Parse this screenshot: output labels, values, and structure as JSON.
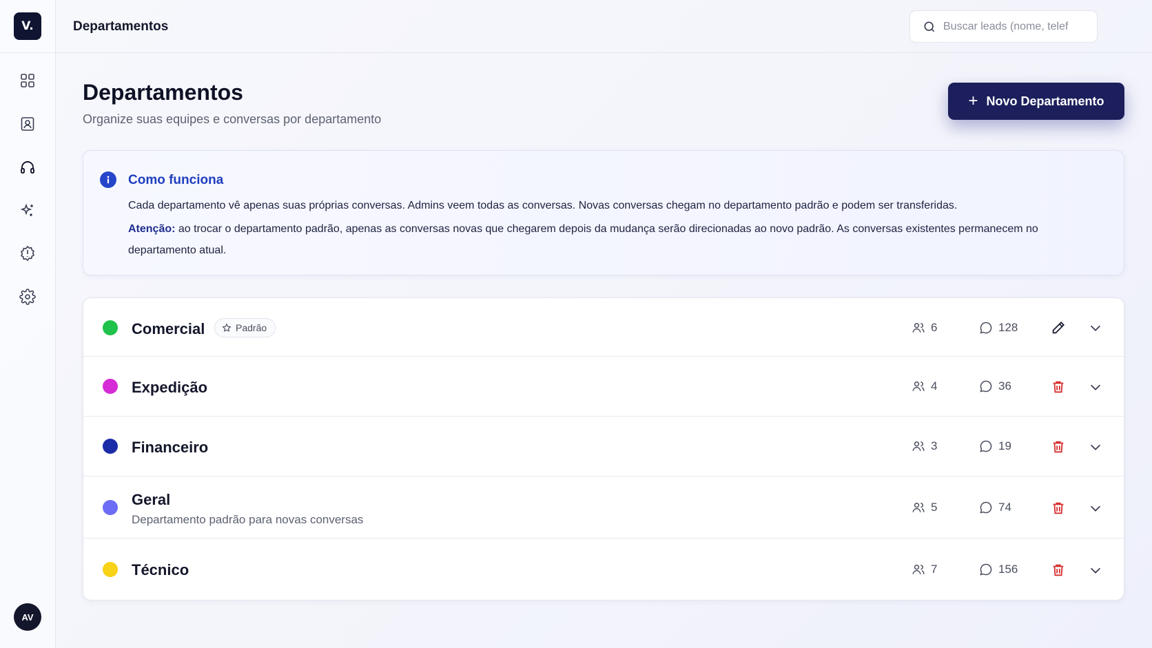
{
  "app": {
    "logo": "V.",
    "avatar": "AV"
  },
  "header": {
    "title": "Departamentos",
    "search_placeholder": "Buscar leads (nome, telef"
  },
  "page": {
    "title": "Departamentos",
    "subtitle": "Organize suas equipes e conversas por departamento",
    "new_button": "Novo Departamento"
  },
  "info": {
    "title": "Como funciona",
    "text": "Cada departamento vê apenas suas próprias conversas. Admins veem todas as conversas. Novas conversas chegam no departamento padrão e podem ser transferidas.",
    "attention_label": "Atenção:",
    "attention_text": " ao trocar o departamento padrão, apenas as conversas novas que chegarem depois da mudança serão direcionadas ao novo padrão. As conversas existentes permanecem no departamento atual."
  },
  "departments": [
    {
      "name": "Comercial",
      "color": "#1fc24a",
      "badge": "Padrão",
      "members": "6",
      "conversations": "128"
    },
    {
      "name": "Expedição",
      "color": "#d62ad6",
      "members": "4",
      "conversations": "36"
    },
    {
      "name": "Financeiro",
      "color": "#1c2ba8",
      "members": "3",
      "conversations": "19"
    },
    {
      "name": "Geral",
      "color": "#6c6cf5",
      "description": "Departamento padrão para novas conversas",
      "members": "5",
      "conversations": "74"
    },
    {
      "name": "Técnico",
      "color": "#f7d216",
      "members": "7",
      "conversations": "156"
    }
  ],
  "icons": {
    "nav": [
      "grid-icon",
      "contacts-icon",
      "headset-icon",
      "sparkles-icon",
      "badge-icon",
      "gear-icon"
    ],
    "search": "search-icon",
    "bell": "bell-icon"
  }
}
